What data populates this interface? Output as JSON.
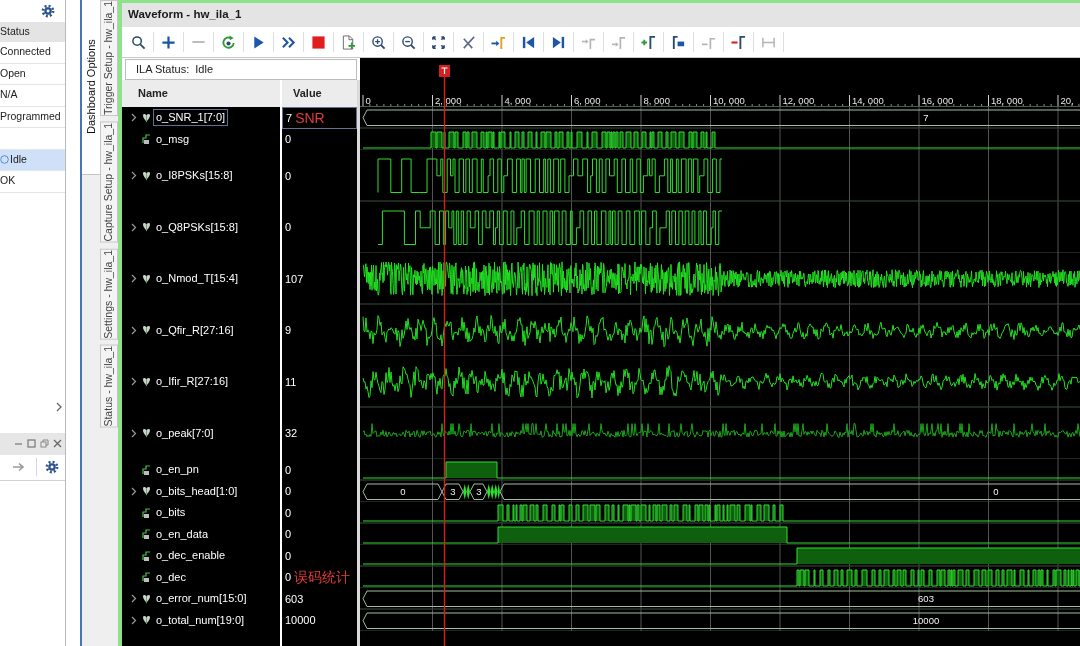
{
  "left_panel": {
    "header": "Status",
    "rows": [
      {
        "kind": "text",
        "value": "Connected",
        "selected": false
      },
      {
        "kind": "text",
        "value": "Open",
        "selected": false
      },
      {
        "kind": "text",
        "value": "N/A",
        "selected": false
      },
      {
        "kind": "text",
        "value": "Programmed",
        "selected": false
      },
      {
        "kind": "blank",
        "selected": false
      },
      {
        "kind": "status",
        "value": "Idle",
        "selected": true
      },
      {
        "kind": "text",
        "value": "OK",
        "selected": false
      }
    ]
  },
  "dashboard_tabs": [
    {
      "label": "Dashboard Options",
      "selected": true
    }
  ],
  "side_tabs": [
    {
      "label": "Trigger Setup - hw_ila_1",
      "selected": false
    },
    {
      "label": "Capture Setup - hw_ila_1",
      "selected": false
    },
    {
      "label": "Settings - hw_ila_1",
      "selected": false
    },
    {
      "label": "Status - hw_ila_1",
      "selected": false
    }
  ],
  "waveform": {
    "title": "Waveform - hw_ila_1",
    "toolbar": [
      {
        "disabled": false
      },
      {
        "disabled": false
      },
      {
        "disabled": true
      },
      {
        "disabled": false
      },
      {
        "disabled": false
      },
      {
        "disabled": false
      },
      {
        "disabled": false
      },
      {
        "disabled": false
      },
      {
        "disabled": false
      },
      {
        "disabled": false
      },
      {
        "disabled": false
      },
      {
        "disabled": false
      },
      {
        "disabled": false
      },
      {
        "disabled": false
      },
      {
        "disabled": false
      },
      {
        "disabled": true
      },
      {
        "disabled": true
      },
      {
        "disabled": false
      },
      {
        "disabled": false
      },
      {
        "disabled": true
      },
      {
        "disabled": false
      },
      {
        "disabled": true
      }
    ],
    "ila_status": "ILA Status:  Idle",
    "columns": [
      "Name",
      "Value"
    ],
    "ruler": [
      "0",
      "2, 000",
      "4, 000",
      "6, 000",
      "8, 000",
      "10, 000",
      "12, 000",
      "14, 000",
      "16, 000",
      "18, 000",
      "20,"
    ],
    "signals": [
      {
        "name": "o_SNR_1[7:0]",
        "value": "7",
        "annotation": "SNR",
        "kind": "bus",
        "expanded": false,
        "selected": true,
        "wave_labels": [
          "7"
        ]
      },
      {
        "name": "o_msg",
        "value": "0",
        "kind": "bit",
        "selected": false
      },
      {
        "name": "o_I8PSKs[15:8]",
        "value": "0",
        "kind": "bus",
        "expanded": false,
        "selected": false
      },
      {
        "name": "o_Q8PSKs[15:8]",
        "value": "0",
        "kind": "bus",
        "expanded": false,
        "selected": false
      },
      {
        "name": "o_Nmod_T[15:4]",
        "value": "107",
        "kind": "bus",
        "expanded": false,
        "selected": false
      },
      {
        "name": "o_Qfir_R[27:16]",
        "value": "9",
        "kind": "bus",
        "expanded": false,
        "selected": false
      },
      {
        "name": "o_Ifir_R[27:16]",
        "value": "11",
        "kind": "bus",
        "expanded": false,
        "selected": false
      },
      {
        "name": "o_peak[7:0]",
        "value": "32",
        "kind": "bus",
        "expanded": false,
        "selected": false
      },
      {
        "name": "o_en_pn",
        "value": "0",
        "kind": "bit",
        "selected": false
      },
      {
        "name": "o_bits_head[1:0]",
        "value": "0",
        "kind": "bus",
        "expanded": false,
        "selected": false,
        "wave_labels": [
          "0",
          "3",
          "3",
          "0"
        ]
      },
      {
        "name": "o_bits",
        "value": "0",
        "kind": "bit",
        "selected": false
      },
      {
        "name": "o_en_data",
        "value": "0",
        "kind": "bit",
        "selected": false
      },
      {
        "name": "o_dec_enable",
        "value": "0",
        "kind": "bit",
        "selected": false
      },
      {
        "name": "o_dec",
        "value": "0",
        "annotation": "误码统计",
        "kind": "bit",
        "selected": false
      },
      {
        "name": "o_error_num[15:0]",
        "value": "603",
        "kind": "bus",
        "expanded": false,
        "selected": false,
        "wave_labels": [
          "603"
        ]
      },
      {
        "name": "o_total_num[19:0]",
        "value": "10000",
        "kind": "bus",
        "expanded": false,
        "selected": false,
        "wave_labels": [
          "10000"
        ]
      }
    ]
  }
}
